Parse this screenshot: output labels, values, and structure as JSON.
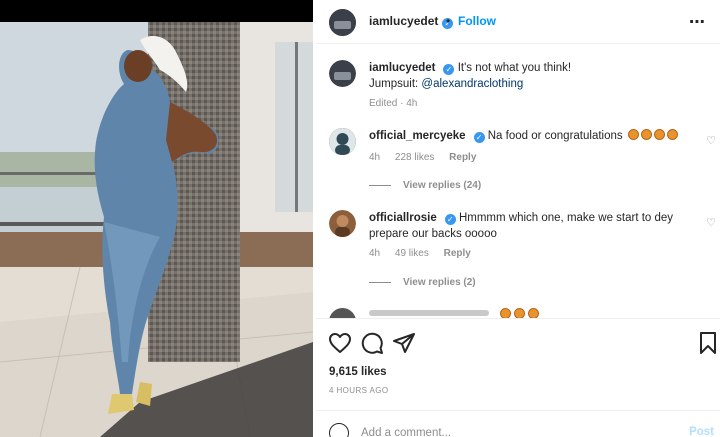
{
  "header": {
    "username": "iamlucyedet",
    "separator": "•",
    "follow_label": "Follow",
    "more_icon": "more-options-icon"
  },
  "caption": {
    "username": "iamlucyedet",
    "line1": "It's not what you think!",
    "line2_prefix": "Jumpsuit: ",
    "mention": "@alexandraclothing",
    "meta": "Edited · 4h"
  },
  "comments": [
    {
      "username": "official_mercyeke",
      "text": "Na food or congratulations",
      "emoji_count": 4,
      "age": "4h",
      "likes": "228 likes",
      "reply_label": "Reply",
      "view_replies": "View replies (24)"
    },
    {
      "username": "officiallrosie",
      "text": "Hmmmm which one, make we start to dey prepare our backs ooooo",
      "age": "4h",
      "likes": "49 likes",
      "reply_label": "Reply",
      "view_replies": "View replies (2)"
    }
  ],
  "stats": {
    "likes": "9,615 likes",
    "ago": "4 HOURS AGO"
  },
  "add_comment": {
    "placeholder": "Add a comment...",
    "post_label": "Post"
  },
  "colors": {
    "accent": "#0095f6",
    "verified": "#3897f0",
    "muted": "#8e8e8e",
    "post_disabled": "#b2dffc"
  }
}
